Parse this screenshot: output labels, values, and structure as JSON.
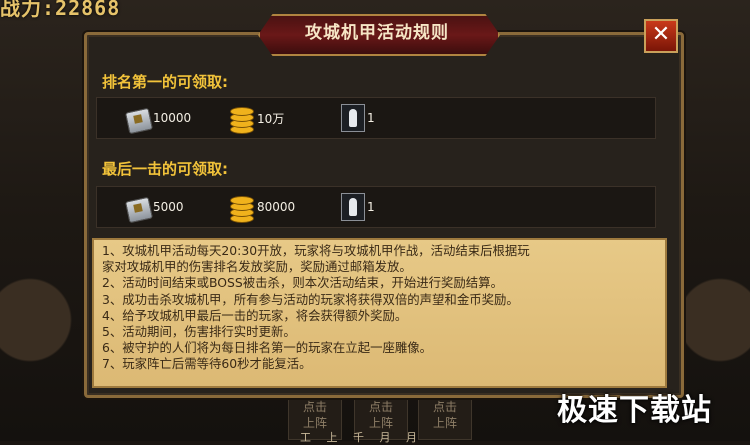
{
  "header": {
    "power_text": "战力:22868"
  },
  "dialog": {
    "title": "攻城机甲活动规则",
    "close_label": "✕"
  },
  "first_place": {
    "heading": "排名第一的可领取:",
    "rewards": [
      {
        "icon": "token-tag-icon",
        "value": "10000"
      },
      {
        "icon": "gold-coins-icon",
        "value": "10万"
      },
      {
        "icon": "statue-icon",
        "value": "1"
      }
    ]
  },
  "last_hit": {
    "heading": "最后一击的可领取:",
    "rewards": [
      {
        "icon": "token-tag-icon",
        "value": "5000"
      },
      {
        "icon": "gold-coins-icon",
        "value": "80000"
      },
      {
        "icon": "statue-icon",
        "value": "1"
      }
    ]
  },
  "rules": [
    "1、攻城机甲活动每天20:30开放，玩家将与攻城机甲作战，活动结束后根据玩",
    "家对攻城机甲的伤害排名发放奖励，奖励通过邮箱发放。",
    "2、活动时间结束或BOSS被击杀，则本次活动结束，开始进行奖励结算。",
    "3、成功击杀攻城机甲，所有参与活动的玩家将获得双倍的声望和金币奖励。",
    "4、给予攻城机甲最后一击的玩家，将会获得额外奖励。",
    "5、活动期间，伤害排行实时更新。",
    "6、被守护的人们将为每日排名第一的玩家在立起一座雕像。",
    "7、玩家阵亡后需等待60秒才能复活。"
  ],
  "bottom_buttons": [
    {
      "line1": "点击",
      "line2": "上阵"
    },
    {
      "line1": "点击",
      "line2": "上阵"
    },
    {
      "line1": "点击",
      "line2": "上阵"
    }
  ],
  "bottom_strip": "工 上 千 月 月",
  "watermark": "极速下载站",
  "colors": {
    "accent_gold": "#f2c33a",
    "title_red": "#6a1818",
    "parchment": "#e2c17d"
  }
}
